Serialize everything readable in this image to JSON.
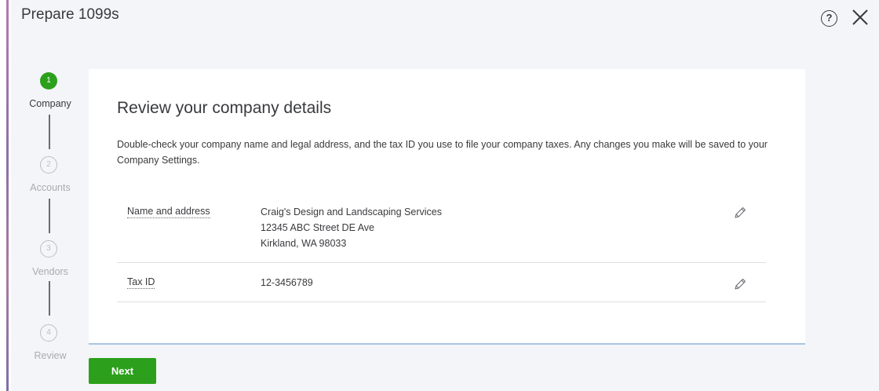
{
  "header": {
    "title": "Prepare 1099s",
    "help_icon_glyph": "?",
    "help_icon": "question-circle-icon",
    "close_icon": "close-x-icon"
  },
  "stepper": {
    "steps": [
      {
        "number": "1",
        "label": "Company",
        "state": "active"
      },
      {
        "number": "2",
        "label": "Accounts",
        "state": "inactive"
      },
      {
        "number": "3",
        "label": "Vendors",
        "state": "inactive"
      },
      {
        "number": "4",
        "label": "Review",
        "state": "inactive"
      }
    ]
  },
  "card": {
    "title": "Review your company details",
    "description": "Double-check your company name and legal address, and the tax ID you use to file your company taxes. Any changes you make will be saved to your Company Settings.",
    "rows": [
      {
        "label": "Name and address",
        "value_lines": [
          "Craig's Design and Landscaping Services",
          "12345 ABC Street DE Ave",
          "Kirkland, WA 98033"
        ],
        "edit_icon": "pencil-icon"
      },
      {
        "label": "Tax ID",
        "value_lines": [
          "12-3456789"
        ],
        "edit_icon": "pencil-icon"
      }
    ]
  },
  "footer": {
    "next_label": "Next"
  },
  "colors": {
    "accent_green": "#2ca01c",
    "text": "#393a3d",
    "muted": "#a8abb1",
    "page_bg": "#f4f5f8"
  }
}
